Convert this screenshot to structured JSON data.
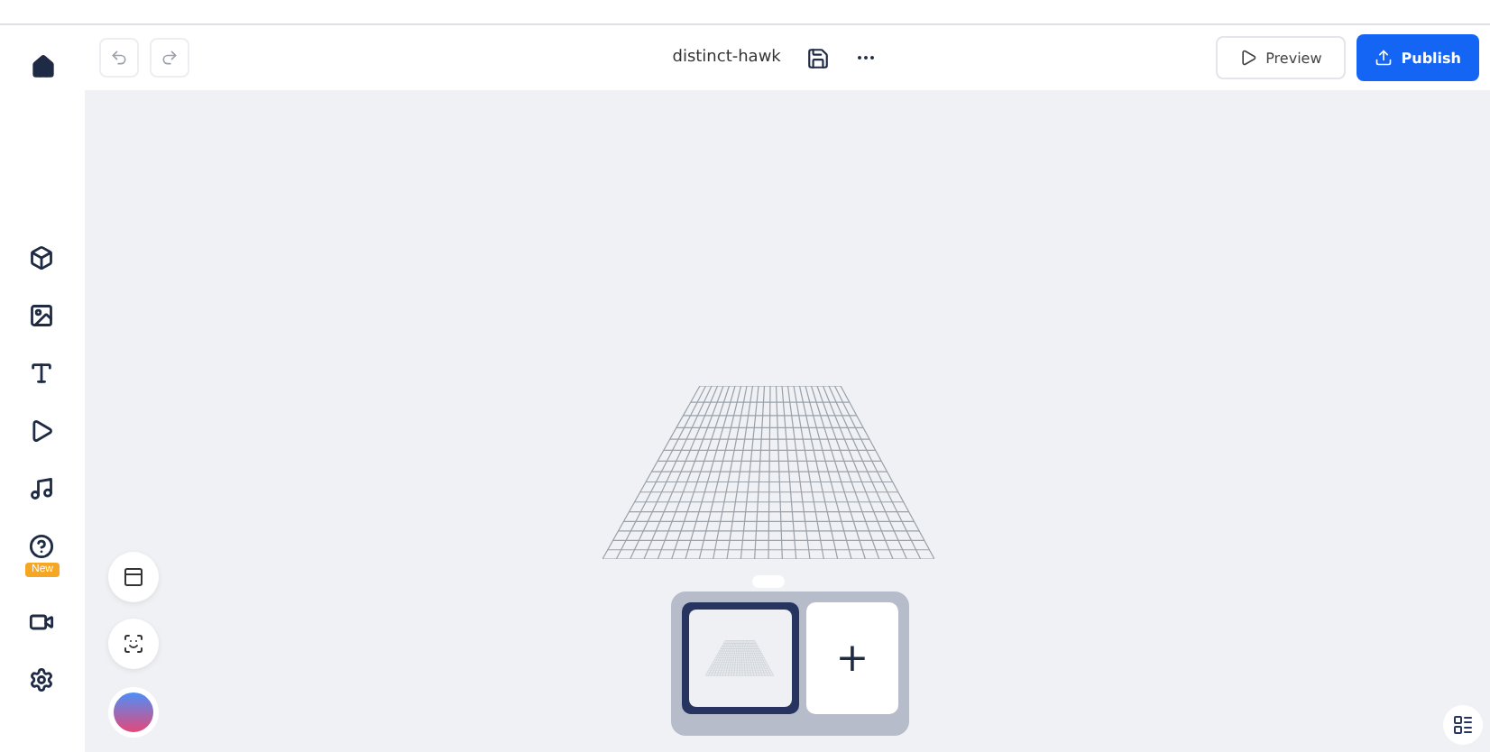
{
  "header": {
    "project_name": "distinct-hawk",
    "preview_label": "Preview",
    "publish_label": "Publish"
  },
  "sidebar": {
    "items": [
      {
        "kind": "objects"
      },
      {
        "kind": "images"
      },
      {
        "kind": "text"
      },
      {
        "kind": "video"
      },
      {
        "kind": "audio"
      },
      {
        "kind": "help",
        "badge": "New"
      },
      {
        "kind": "camera"
      },
      {
        "kind": "settings"
      }
    ]
  },
  "scenes": {
    "add_label": "+"
  }
}
